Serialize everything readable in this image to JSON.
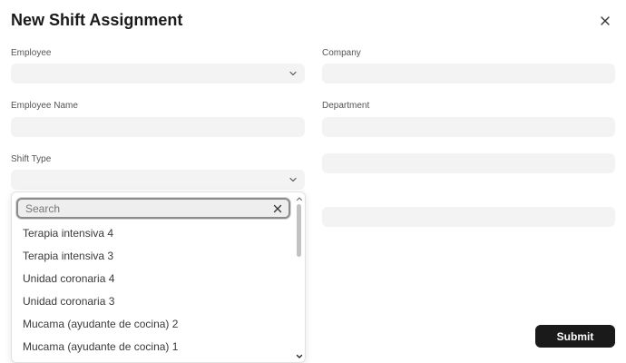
{
  "dialog": {
    "title": "New Shift Assignment",
    "close_icon": "close-icon"
  },
  "form": {
    "left": {
      "employee_label": "Employee",
      "employee_name_label": "Employee Name",
      "shift_type_label": "Shift Type"
    },
    "right": {
      "company_label": "Company",
      "department_label": "Department"
    }
  },
  "dropdown": {
    "search_placeholder": "Search",
    "search_value": "",
    "options": [
      "Terapia intensiva 4",
      "Terapia intensiva 3",
      "Unidad coronaria 4",
      "Unidad coronaria 3",
      "Mucama (ayudante de cocina) 2",
      "Mucama (ayudante de cocina) 1"
    ]
  },
  "actions": {
    "submit_label": "Submit"
  },
  "icons": {
    "close": "close-icon",
    "chevron": "chevron-down-icon",
    "clear": "clear-icon"
  },
  "colors": {
    "field_bg": "#f3f3f3",
    "primary_button": "#1a1a1a"
  }
}
